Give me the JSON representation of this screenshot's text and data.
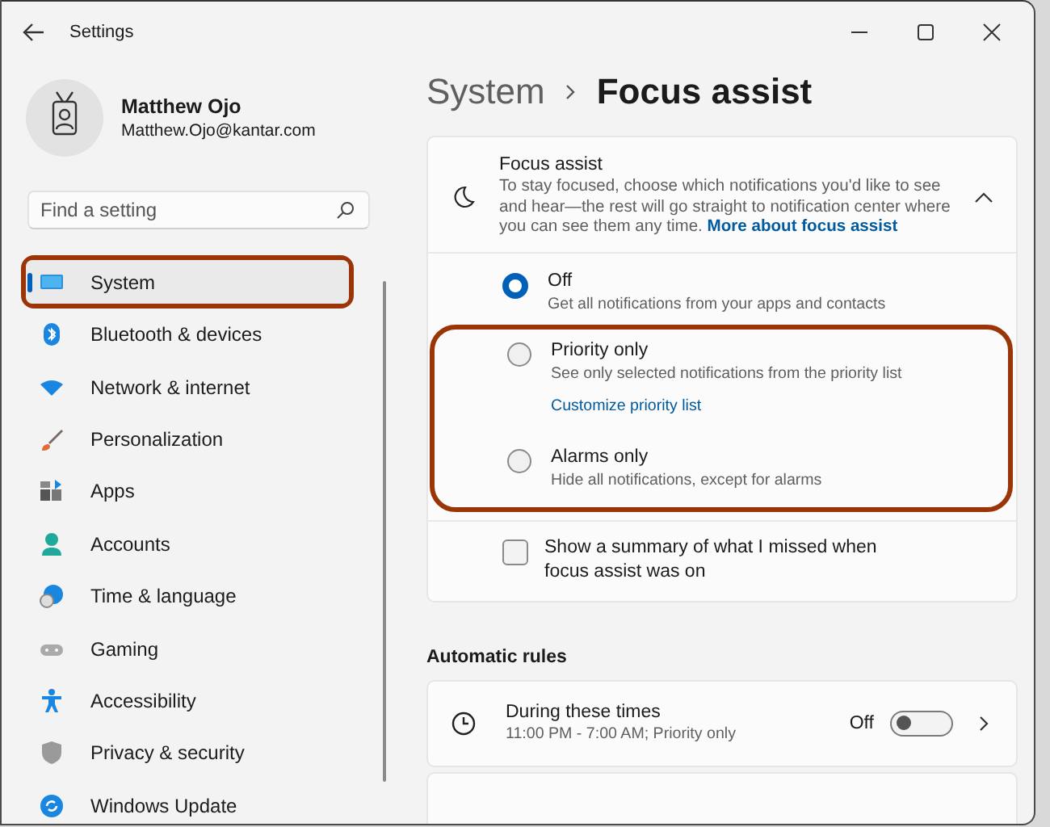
{
  "window": {
    "title": "Settings"
  },
  "profile": {
    "name": "Matthew Ojo",
    "email": "Matthew.Ojo@kantar.com"
  },
  "search": {
    "placeholder": "Find a setting"
  },
  "sidebar": {
    "items": [
      {
        "label": "System",
        "selected": true,
        "highlighted": true
      },
      {
        "label": "Bluetooth & devices",
        "selected": false,
        "highlighted": false
      },
      {
        "label": "Network & internet",
        "selected": false,
        "highlighted": false
      },
      {
        "label": "Personalization",
        "selected": false,
        "highlighted": false
      },
      {
        "label": "Apps",
        "selected": false,
        "highlighted": false
      },
      {
        "label": "Accounts",
        "selected": false,
        "highlighted": false
      },
      {
        "label": "Time & language",
        "selected": false,
        "highlighted": false
      },
      {
        "label": "Gaming",
        "selected": false,
        "highlighted": false
      },
      {
        "label": "Accessibility",
        "selected": false,
        "highlighted": false
      },
      {
        "label": "Privacy & security",
        "selected": false,
        "highlighted": false
      },
      {
        "label": "Windows Update",
        "selected": false,
        "highlighted": false
      }
    ]
  },
  "breadcrumb": {
    "parent": "System",
    "current": "Focus assist"
  },
  "focus_card": {
    "title": "Focus assist",
    "description": "To stay focused, choose which notifications you'd like to see and hear—the rest will go straight to notification center where you can see them any time.",
    "link": "More about focus assist",
    "expanded": true,
    "options": [
      {
        "label": "Off",
        "description": "Get all notifications from your apps and contacts",
        "selected": true,
        "highlighted": false
      },
      {
        "label": "Priority only",
        "description": "See only selected notifications from the priority list",
        "link": "Customize priority list",
        "selected": false,
        "highlighted": true
      },
      {
        "label": "Alarms only",
        "description": "Hide all notifications, except for alarms",
        "selected": false,
        "highlighted": true
      }
    ],
    "summary_checkbox": {
      "label": "Show a summary of what I missed when focus assist was on",
      "checked": false
    }
  },
  "automatic_rules": {
    "heading": "Automatic rules",
    "rules": [
      {
        "title": "During these times",
        "subtitle": "11:00 PM - 7:00 AM; Priority only",
        "state_label": "Off",
        "on": false
      }
    ]
  }
}
